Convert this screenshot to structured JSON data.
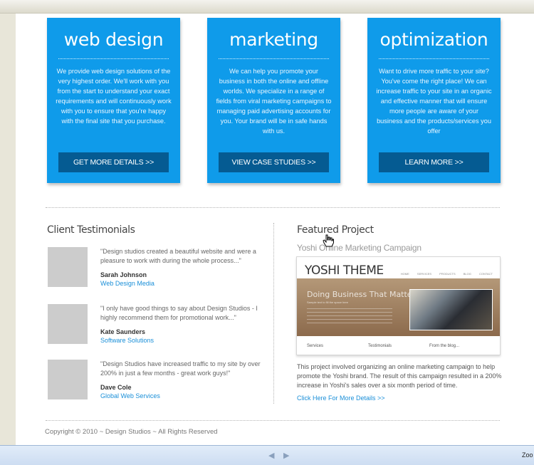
{
  "services": [
    {
      "title": "web design",
      "text": "We provide web design solutions of the very highest order. We'll work with you from the start to understand your exact requirements and will continuously work with you to ensure that you're happy with the final site that you purchase.",
      "button": "GET MORE DETAILS >>"
    },
    {
      "title": "marketing",
      "text": "We can help you promote your business in both the online and offline worlds. We specialize in a range of fields from viral marketing campaigns to managing paid advertising accounts for you. Your brand will be in safe hands with us.",
      "button": "VIEW CASE STUDIES >>"
    },
    {
      "title": "optimization",
      "text": "Want to drive more traffic to your site? You've come the right place! We can increase traffic to your site in an organic and effective manner that will ensure more people are aware of your business and the products/services you offer",
      "button": "LEARN MORE >>"
    }
  ],
  "testimonials": {
    "heading": "Client Testimonials",
    "items": [
      {
        "quote": "\"Design studios created a beautiful website and were a pleasure to work with during the whole process...\"",
        "name": "Sarah Johnson",
        "company": "Web Design Media"
      },
      {
        "quote": "\"I only have good things to say about Design Studios - I highly recommend them for promotional work...\"",
        "name": "Kate Saunders",
        "company": "Software Solutions"
      },
      {
        "quote": "\"Design Studios have increased traffic to my site by over 200% in just a few months - great work guys!\"",
        "name": "Dave Cole",
        "company": "Global Web Services"
      }
    ]
  },
  "featured": {
    "heading": "Featured Project",
    "subtitle": "Yoshi Online Marketing Campaign",
    "preview": {
      "logo": "YOSHI THEME",
      "nav": "HOME SERVICES PRODUCTS BLOG CONTACT",
      "banner_title": "Doing Business That Matters",
      "banner_sub": "Sample text to fill the space here",
      "columns": [
        "Services",
        "Testimonials",
        "From the blog..."
      ]
    },
    "description": "This project involved organizing an online marketing campaign to help promote the Yoshi brand. The result of this campaign resulted in a 200% increase in Yoshi's sales over a six month period of time.",
    "link": "Click Here For More Details >>"
  },
  "footer": {
    "copyright": "Copyright © 2010 ~ Design Studios ~ All Rights Reserved"
  },
  "viewer": {
    "prev_arrow": "◀",
    "next_arrow": "▶",
    "zoom_label": "Zoo"
  },
  "colors": {
    "box_blue": "#0f9bea",
    "button_dark": "#055b92",
    "link_blue": "#1a8fd8"
  }
}
